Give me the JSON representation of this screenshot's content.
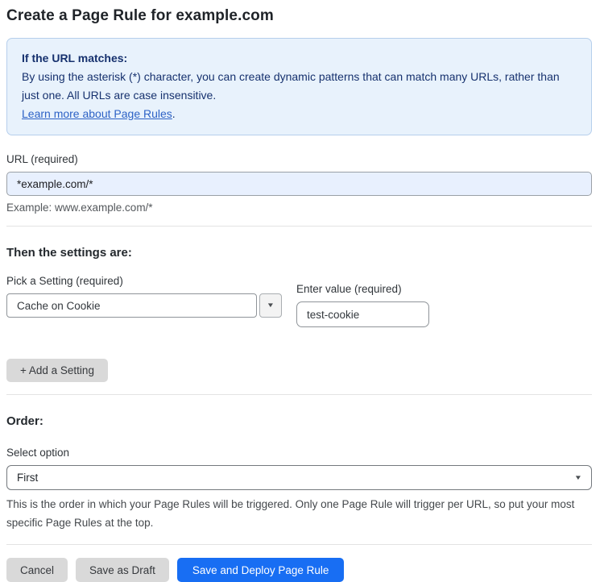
{
  "page": {
    "title": "Create a Page Rule for example.com"
  },
  "info_box": {
    "heading": "If the URL matches:",
    "body": "By using the asterisk (*) character, you can create dynamic patterns that can match many URLs, rather than just one. All URLs are case insensitive.",
    "link_label": "Learn more about Page Rules",
    "link_suffix": "."
  },
  "url_field": {
    "label": "URL (required)",
    "value": "*example.com/*",
    "hint": "Example: www.example.com/*"
  },
  "settings": {
    "heading": "Then the settings are:",
    "setting_label": "Pick a Setting (required)",
    "setting_value": "Cache on Cookie",
    "value_label": "Enter value (required)",
    "value_text": "test-cookie",
    "add_button_label": "+ Add a Setting"
  },
  "order": {
    "heading": "Order:",
    "label": "Select option",
    "selected_option": "First",
    "help": "This is the order in which your Page Rules will be triggered. Only one Page Rule will trigger per URL, so put your most specific Page Rules at the top."
  },
  "actions": {
    "cancel_label": "Cancel",
    "save_draft_label": "Save as Draft",
    "save_deploy_label": "Save and Deploy Page Rule"
  },
  "icons": {
    "dropdown_arrow": "▼"
  },
  "colors": {
    "accent_blue": "#186ef3",
    "info_box_bg": "#e8f2fc",
    "info_box_border": "#b6cfec",
    "info_box_text": "#16316e",
    "link_blue": "#2d62c6",
    "url_input_bg": "#e8f0fe",
    "gray_button_bg": "#d9d9d9"
  }
}
